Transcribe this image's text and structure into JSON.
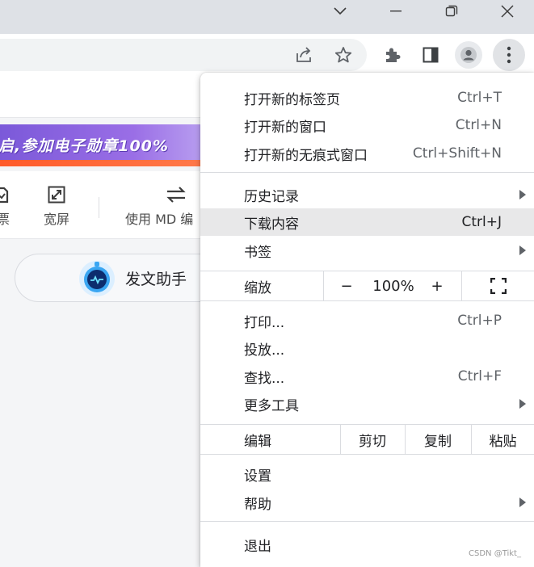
{
  "window": {
    "controls": [
      "tab-search-icon",
      "minimize-icon",
      "restore-icon",
      "close-icon"
    ]
  },
  "toolbar": {
    "icons": [
      "share-icon",
      "bookmark-star-icon",
      "extensions-icon",
      "side-panel-icon",
      "profile-icon",
      "more-menu-icon"
    ]
  },
  "page": {
    "banner_text": "启,参加电子勋章100%",
    "editor_tools": [
      {
        "label": "票",
        "icon": "ticket-icon"
      },
      {
        "label": "宽屏",
        "icon": "widescreen-icon"
      },
      {
        "label": "使用 MD 编",
        "icon": "switch-editor-icon"
      }
    ],
    "assistant_label": "发文助手"
  },
  "menu": {
    "items_group1": [
      {
        "label": "打开新的标签页",
        "shortcut": "Ctrl+T"
      },
      {
        "label": "打开新的窗口",
        "shortcut": "Ctrl+N"
      },
      {
        "label": "打开新的无痕式窗口",
        "shortcut": "Ctrl+Shift+N"
      }
    ],
    "items_group2": [
      {
        "label": "历史记录",
        "shortcut": "",
        "submenu": true
      },
      {
        "label": "下载内容",
        "shortcut": "Ctrl+J",
        "highlighted": true
      },
      {
        "label": "书签",
        "shortcut": "",
        "submenu": true
      }
    ],
    "zoom": {
      "label": "缩放",
      "minus": "−",
      "value": "100%",
      "plus": "+",
      "fullscreen_icon": "fullscreen-icon"
    },
    "items_group3": [
      {
        "label": "打印...",
        "shortcut": "Ctrl+P"
      },
      {
        "label": "投放...",
        "shortcut": ""
      },
      {
        "label": "查找...",
        "shortcut": "Ctrl+F"
      },
      {
        "label": "更多工具",
        "shortcut": "",
        "submenu": true
      }
    ],
    "edit": {
      "label": "编辑",
      "cut": "剪切",
      "copy": "复制",
      "paste": "粘贴"
    },
    "items_group4": [
      {
        "label": "设置",
        "shortcut": ""
      },
      {
        "label": "帮助",
        "shortcut": "",
        "submenu": true
      }
    ],
    "exit": {
      "label": "退出"
    }
  },
  "watermark": "CSDN @Tikt_"
}
